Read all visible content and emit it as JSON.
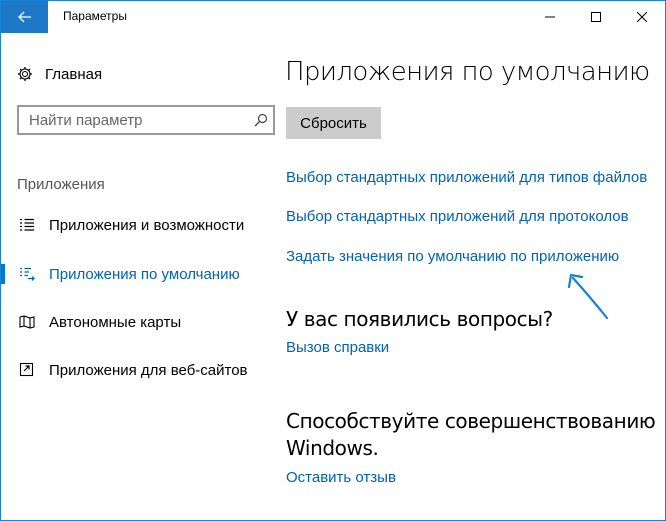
{
  "window": {
    "title": "Параметры",
    "controls": [
      "minimize",
      "maximize",
      "close"
    ]
  },
  "sidebar": {
    "home_label": "Главная",
    "search": {
      "placeholder": "Найти параметр",
      "value": ""
    },
    "section_label": "Приложения",
    "items": [
      {
        "label": "Приложения и возможности",
        "icon": "apps-list-icon",
        "active": false
      },
      {
        "label": "Приложения по умолчанию",
        "icon": "default-apps-icon",
        "active": true
      },
      {
        "label": "Автономные карты",
        "icon": "map-icon",
        "active": false
      },
      {
        "label": "Приложения для веб-сайтов",
        "icon": "web-apps-icon",
        "active": false
      }
    ]
  },
  "main": {
    "title": "Приложения по умолчанию",
    "reset_label": "Сбросить",
    "links": [
      "Выбор стандартных приложений для типов файлов",
      "Выбор стандартных приложений для протоколов",
      "Задать значения по умолчанию по приложению"
    ],
    "questions": {
      "heading": "У вас появились вопросы?",
      "link": "Вызов справки"
    },
    "improve": {
      "heading_line1": "Способствуйте совершенствованию",
      "heading_line2": "Windows.",
      "link": "Оставить отзыв"
    }
  },
  "colors": {
    "accent": "#0078d7",
    "back_button": "#1e78c8",
    "link": "#0063b1",
    "button_bg": "#cccccc",
    "annotation_arrow": "#1a7fd4"
  }
}
